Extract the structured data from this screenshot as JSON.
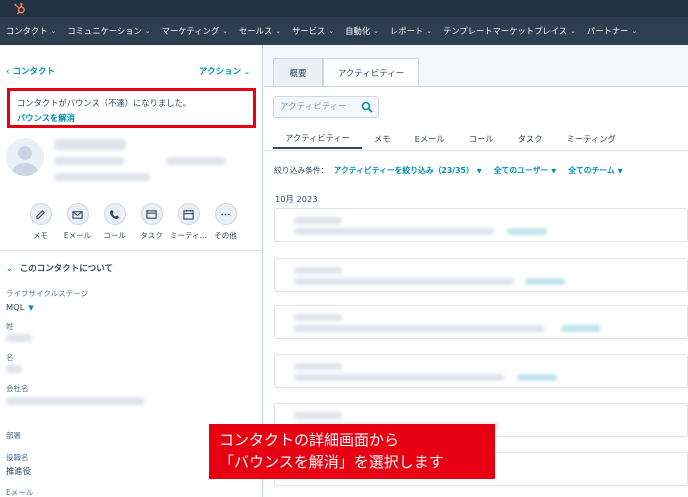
{
  "nav": {
    "items": [
      "コンタクト",
      "コミュニケーション",
      "マーケティング",
      "セールス",
      "サービス",
      "自動化",
      "レポート",
      "テンプレートマーケットプレイス",
      "パートナー"
    ]
  },
  "sidebar": {
    "back_link": "‹ コンタクト",
    "actions_menu": "アクション",
    "alert": {
      "message": "コンタクトがバウンス（不達）になりました。",
      "link": "バウンスを解消"
    },
    "quick_actions": [
      {
        "label": "メモ",
        "icon": "note-icon"
      },
      {
        "label": "Eメール",
        "icon": "email-icon"
      },
      {
        "label": "コール",
        "icon": "phone-icon"
      },
      {
        "label": "タスク",
        "icon": "task-icon"
      },
      {
        "label": "ミーティ…",
        "icon": "calendar-icon"
      },
      {
        "label": "その他",
        "icon": "more-icon"
      }
    ],
    "about_section": "このコンタクトについて",
    "fields": {
      "lifecycle_label": "ライフサイクルステージ",
      "lifecycle_value": "MQL",
      "last_name_label": "姓",
      "first_name_label": "名",
      "company_label": "会社名",
      "department_label": "部署",
      "job_title_label": "役職名",
      "job_title_value": "推進役",
      "email_label": "Eメール"
    }
  },
  "main": {
    "tabs": {
      "overview": "概要",
      "activity": "アクティビティー"
    },
    "search_placeholder": "アクティビティー",
    "subtabs": [
      "アクティビティー",
      "メモ",
      "Eメール",
      "コール",
      "タスク",
      "ミーティング"
    ],
    "filter": {
      "label": "絞り込み条件：",
      "activity": "アクティビティーを絞り込み（23/35）",
      "users": "全てのユーザー",
      "teams": "全てのチーム"
    },
    "month": "10月 2023"
  },
  "caption": {
    "line1": "コンタクトの詳細画面から",
    "line2": "「バウンスを解消」を選択します"
  },
  "colors": {
    "topbar": "#213343",
    "navbar": "#2d3e50",
    "link": "#0091ae",
    "highlight": "#e60012"
  }
}
